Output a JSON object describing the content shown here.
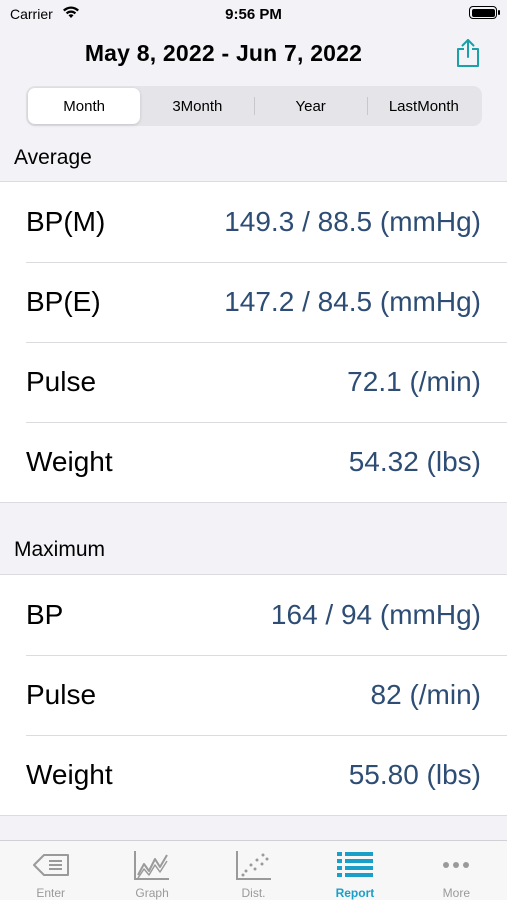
{
  "status_bar": {
    "carrier": "Carrier",
    "time": "9:56 PM"
  },
  "header": {
    "date_range": "May 8, 2022 - Jun 7, 2022",
    "share_icon": "share-icon"
  },
  "segments": [
    {
      "label": "Month",
      "selected": true
    },
    {
      "label": "3Month",
      "selected": false
    },
    {
      "label": "Year",
      "selected": false
    },
    {
      "label": "LastMonth",
      "selected": false
    }
  ],
  "average": {
    "title": "Average",
    "rows": [
      {
        "label": "BP(M)",
        "value": "149.3 / 88.5 (mmHg)"
      },
      {
        "label": "BP(E)",
        "value": "147.2 / 84.5 (mmHg)"
      },
      {
        "label": "Pulse",
        "value": "72.1 (/min)"
      },
      {
        "label": "Weight",
        "value": "54.32 (lbs)"
      }
    ]
  },
  "maximum": {
    "title": "Maximum",
    "rows": [
      {
        "label": "BP",
        "value": "164 / 94 (mmHg)"
      },
      {
        "label": "Pulse",
        "value": "82 (/min)"
      },
      {
        "label": "Weight",
        "value": "55.80 (lbs)"
      }
    ]
  },
  "tabs": [
    {
      "label": "Enter",
      "icon": "enter-icon",
      "active": false
    },
    {
      "label": "Graph",
      "icon": "graph-icon",
      "active": false
    },
    {
      "label": "Dist.",
      "icon": "scatter-icon",
      "active": false
    },
    {
      "label": "Report",
      "icon": "report-list-icon",
      "active": true
    },
    {
      "label": "More",
      "icon": "more-dots-icon",
      "active": false
    }
  ],
  "colors": {
    "value_text": "#2e4d74",
    "accent": "#1aa0c8",
    "share_icon": "#1aa0a8",
    "tab_inactive": "#9a9a9a"
  }
}
